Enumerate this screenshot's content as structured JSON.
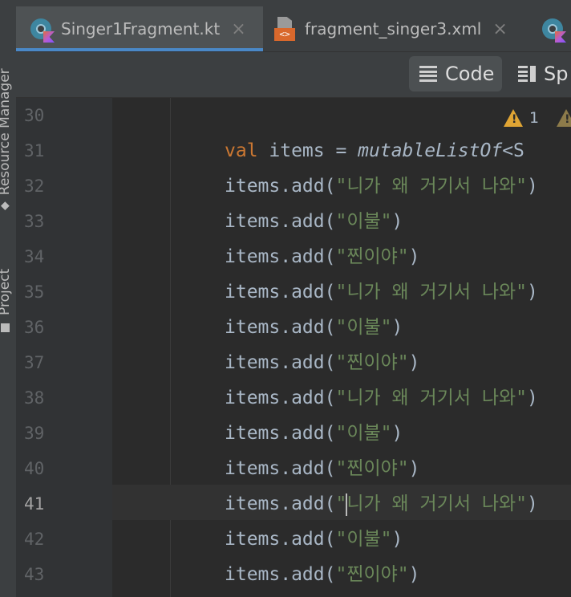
{
  "side_panel": {
    "tabs": [
      {
        "label": "Resource Manager",
        "icon": "resource-manager-icon"
      },
      {
        "label": "Project",
        "icon": "project-icon"
      }
    ]
  },
  "tabs": [
    {
      "label": "Singer1Fragment.kt",
      "icon": "kotlin-file-icon",
      "active": true,
      "close": "×"
    },
    {
      "label": "fragment_singer3.xml",
      "icon": "xml-file-icon",
      "active": false,
      "close": "×"
    }
  ],
  "toolbar": {
    "code_label": "Code",
    "split_label": "Sp"
  },
  "inspection": {
    "warnings": "1"
  },
  "editor": {
    "current_line": "41",
    "lines": [
      {
        "n": "30",
        "pre": "",
        "body": "",
        "post": ""
      },
      {
        "n": "31",
        "kw": "val",
        "ident": " items = ",
        "fn": "mutableListOf",
        "rest": "<S"
      },
      {
        "n": "32",
        "pre": "items.add(",
        "body": "\"니가 왜 거기서 나와\"",
        "post": ")"
      },
      {
        "n": "33",
        "pre": "items.add(",
        "body": "\"이불\"",
        "post": ")"
      },
      {
        "n": "34",
        "pre": "items.add(",
        "body": "\"찐이야\"",
        "post": ")"
      },
      {
        "n": "35",
        "pre": "items.add(",
        "body": "\"니가 왜 거기서 나와\"",
        "post": ")"
      },
      {
        "n": "36",
        "pre": "items.add(",
        "body": "\"이불\"",
        "post": ")"
      },
      {
        "n": "37",
        "pre": "items.add(",
        "body": "\"찐이야\"",
        "post": ")"
      },
      {
        "n": "38",
        "pre": "items.add(",
        "body": "\"니가 왜 거기서 나와\"",
        "post": ")"
      },
      {
        "n": "39",
        "pre": "items.add(",
        "body": "\"이불\"",
        "post": ")"
      },
      {
        "n": "40",
        "pre": "items.add(",
        "body": "\"찐이야\"",
        "post": ")"
      },
      {
        "n": "41",
        "pre": "items.add(",
        "body_a": "\"",
        "body_b": "니가 왜 거기서 나와\"",
        "post": ")"
      },
      {
        "n": "42",
        "pre": "items.add(",
        "body": "\"이불\"",
        "post": ")"
      },
      {
        "n": "43",
        "pre": "items.add(",
        "body": "\"찐이야\"",
        "post": ")"
      }
    ]
  },
  "colors": {
    "keyword": "#cc7832",
    "string": "#6a8759",
    "identifier": "#a9b7c6",
    "accent": "#4a88c7",
    "warning": "#e0a534"
  }
}
